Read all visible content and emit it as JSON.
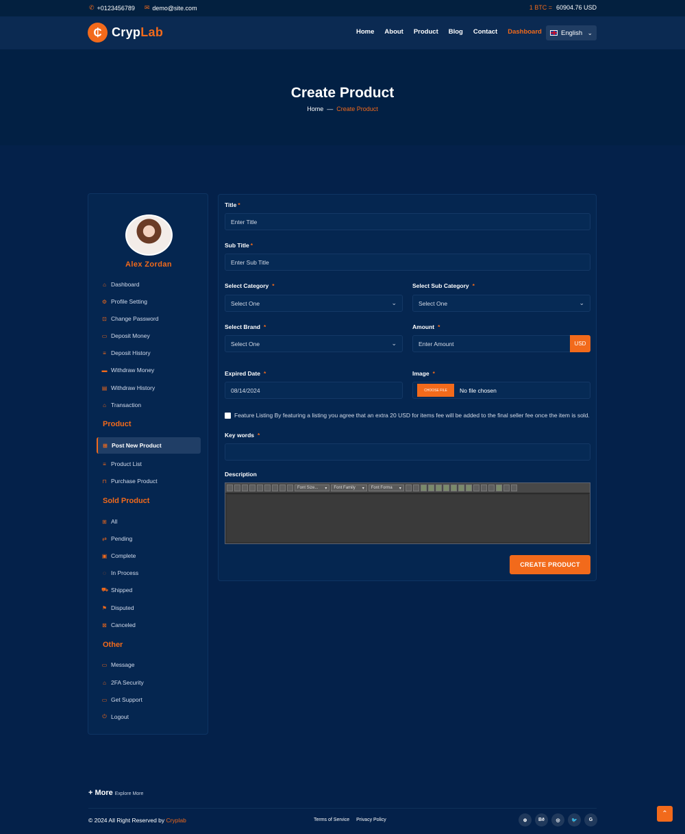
{
  "topbar": {
    "phone": "+0123456789",
    "email": "demo@site.com",
    "btc_label": "1 BTC =",
    "btc_value": "60904.76 USD",
    "phone_icon": "phone-icon",
    "mail_icon": "mail-icon"
  },
  "brand": {
    "logo_letter": "₵",
    "name_part1": "Cryp",
    "name_part2": "Lab"
  },
  "nav": {
    "items": [
      "Home",
      "About",
      "Product",
      "Blog",
      "Contact",
      "Dashboard"
    ],
    "active_index": 5,
    "language": "English"
  },
  "banner": {
    "title": "Create Product",
    "crumb_home": "Home",
    "crumb_sep": "—",
    "crumb_current": "Create Product"
  },
  "sidebar": {
    "user_name": "Alex Zordan",
    "account_items": [
      {
        "label": "Dashboard",
        "icon": "home-icon"
      },
      {
        "label": "Profile Setting",
        "icon": "gear-icon"
      },
      {
        "label": "Change Password",
        "icon": "lock-icon"
      },
      {
        "label": "Deposit Money",
        "icon": "wallet-icon"
      },
      {
        "label": "Deposit History",
        "icon": "list-icon"
      },
      {
        "label": "Withdraw Money",
        "icon": "card-icon"
      },
      {
        "label": "Withdraw History",
        "icon": "doc-icon"
      },
      {
        "label": "Transaction",
        "icon": "home-icon"
      }
    ],
    "product_heading": "Product",
    "product_items": [
      {
        "label": "Post New Product",
        "icon": "post-icon"
      },
      {
        "label": "Product List",
        "icon": "list-icon"
      },
      {
        "label": "Purchase Product",
        "icon": "bag-icon"
      }
    ],
    "sold_heading": "Sold Product",
    "sold_items": [
      {
        "label": "All",
        "icon": "grid-icon"
      },
      {
        "label": "Pending",
        "icon": "swap-icon"
      },
      {
        "label": "Complete",
        "icon": "check-icon"
      },
      {
        "label": "In Process",
        "icon": "spinner-icon"
      },
      {
        "label": "Shipped",
        "icon": "truck-icon"
      },
      {
        "label": "Disputed",
        "icon": "flag-icon"
      },
      {
        "label": "Canceled",
        "icon": "close-icon"
      }
    ],
    "other_heading": "Other",
    "other_items": [
      {
        "label": "Message",
        "icon": "message-icon"
      },
      {
        "label": "2FA Security",
        "icon": "shield-icon"
      },
      {
        "label": "Get Support",
        "icon": "support-icon"
      },
      {
        "label": "Logout",
        "icon": "logout-icon"
      }
    ]
  },
  "form": {
    "title_label": "Title",
    "title_placeholder": "Enter Title",
    "subtitle_label": "Sub Title",
    "subtitle_placeholder": "Enter Sub Title",
    "category_label": "Select Category",
    "category_value": "Select One",
    "subcategory_label": "Select Sub Category",
    "subcategory_value": "Select One",
    "brand_label": "Select Brand",
    "brand_value": "Select One",
    "amount_label": "Amount",
    "amount_placeholder": "Enter Amount",
    "amount_currency": "USD",
    "expired_label": "Expired Date",
    "expired_value": "08/14/2024",
    "image_label": "Image",
    "choose_file": "CHOOSE FILE",
    "no_file": "No file chosen",
    "feature_text": "Feature Listing By featuring a listing you agree that an extra 20 USD for items fee will be added to the final seller fee once the item is sold.",
    "keywords_label": "Key words",
    "description_label": "Description",
    "editor_font_size": "Font Size...",
    "editor_font_family": "Font Family",
    "editor_font_format": "Font Forma",
    "submit_label": "CREATE PRODUCT",
    "required_mark": "*"
  },
  "footer": {
    "more": "+ More",
    "explore": "Explore More",
    "copyright_prefix": "© 2024 All Right Reserved by",
    "copyright_brand": "Cryplab",
    "links": [
      "Terms of Service",
      "Privacy Policy"
    ],
    "social": [
      {
        "glyph": "⊕",
        "icon": "dribbble-icon"
      },
      {
        "glyph": "Bē",
        "icon": "behance-icon"
      },
      {
        "glyph": "◎",
        "icon": "instagram-icon"
      },
      {
        "glyph": "🐦",
        "icon": "twitter-icon"
      },
      {
        "glyph": "G",
        "icon": "google-icon"
      }
    ],
    "totop_icon": "arrow-up-icon"
  },
  "colors": {
    "accent": "#f26a1b",
    "bg": "#04214a",
    "panel": "#052650"
  }
}
